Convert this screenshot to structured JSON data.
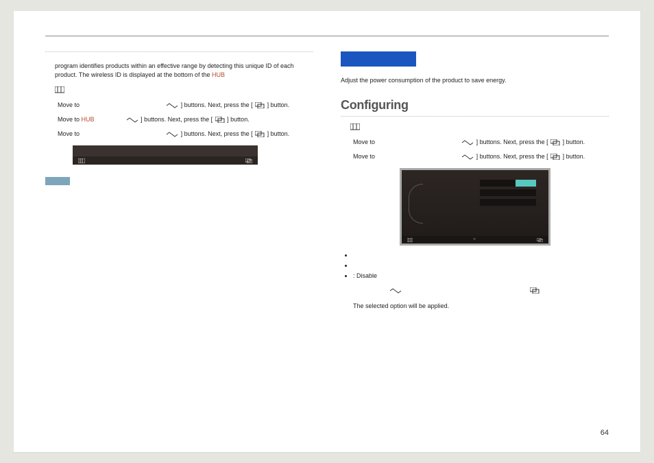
{
  "page_number": "64",
  "left": {
    "intro": " program identifies products within an effective range by detecting this unique ID of each product. The wireless ID is displayed at the bottom of the ",
    "intro_link": "HUB",
    "row1_a": "Move to",
    "row1_b": "] buttons. Next, press the [",
    "row1_c": "] button.",
    "row2_a": "Move to ",
    "row2_link": "HUB",
    "row2_b": "] buttons. Next, press the [",
    "row2_c": "] button.",
    "row3_a": "Move to",
    "row3_b": "] buttons. Next, press the [",
    "row3_c": "] button."
  },
  "right": {
    "lead": "Adjust the power consumption of the product to save energy.",
    "heading": "Configuring",
    "row1_a": "Move to",
    "row1_b": "] buttons. Next, press the [",
    "row1_c": "] button.",
    "row2_a": "Move to",
    "row2_b": "] buttons. Next, press the [",
    "row2_c": "] button.",
    "bullet3": " : Disable",
    "apply": "The selected option will be applied."
  },
  "footbar": {
    "mid": ""
  }
}
